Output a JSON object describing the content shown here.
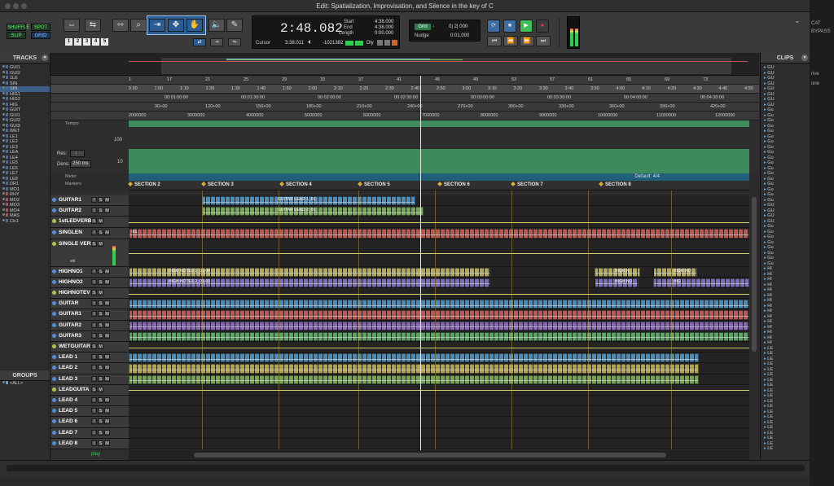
{
  "window": {
    "title": "Edit: Spatialization, Improvisation, and Silence in the key of C"
  },
  "toolbar": {
    "modes": [
      "SHUFFLE",
      "SPOT",
      "SLIP",
      "GRID"
    ],
    "zoom_presets": [
      "1",
      "2",
      "3",
      "4",
      "5"
    ]
  },
  "counter": {
    "main": "2:48.082",
    "start_label": "Start",
    "start": "4:38.000",
    "end_label": "End",
    "end": "4:38.000",
    "length_label": "Length",
    "length": "0:00.000",
    "cursor_label": "Cursor",
    "cursor": "3:38.011",
    "sample": "-1021382",
    "dly": "Dly"
  },
  "grid": {
    "grid_label": "Grid",
    "grid_value": "0| 2| 000",
    "nudge_label": "Nudge",
    "nudge_value": "0:01.000"
  },
  "tracks_panel": {
    "title": "TRACKS",
    "items": [
      "GUI1",
      "GUI2",
      "1LE",
      "SIN",
      "SIN",
      "HIG1",
      "HIG2",
      "HIG",
      "GUIT",
      "GUI1",
      "GUI2",
      "GUI3",
      "WET",
      "LE1",
      "LE2",
      "LE3",
      "LEA",
      "LE4",
      "LE5",
      "LE6",
      "LE7",
      "LE8",
      "DR1",
      "MO1",
      "RHY",
      "MO2",
      "MO3",
      "MO4",
      "MAS",
      "Clc1"
    ]
  },
  "groups_panel": {
    "title": "GROUPS",
    "items": [
      "<ALL>"
    ]
  },
  "clips_panel": {
    "title": "CLIPS",
    "items": [
      "GU",
      "GU",
      "GU",
      "GU",
      "GU",
      "GU",
      "GU",
      "GU",
      "Gu",
      "Gu",
      "Gu",
      "Gu",
      "Gu",
      "Gu",
      "Gu",
      "Gu",
      "Gu",
      "Gu",
      "Gu",
      "Gu",
      "Gu",
      "Gu",
      "Gu",
      "Gu",
      "Gu",
      "Gu",
      "GU",
      "GU",
      "GU",
      "GU",
      "Gu",
      "Gu",
      "Gu",
      "Gu",
      "Gu",
      "Gu",
      "Gu",
      "Gu",
      "HI",
      "HI",
      "HI",
      "HI",
      "HI",
      "HI",
      "HI",
      "HI",
      "HI",
      "HI",
      "HI",
      "HI",
      "HI",
      "HI",
      "HI",
      "LE",
      "LE",
      "LE",
      "LE",
      "LE",
      "LE",
      "LE",
      "LE",
      "LE",
      "LE",
      "LE",
      "LE",
      "LE",
      "LE",
      "LE",
      "LE",
      "LE",
      "LE",
      "LE",
      "LE"
    ]
  },
  "rulers": {
    "labels": [
      "Bars|Beats",
      "Min:Secs",
      "Timecode",
      "Feet+Frames",
      "Samples",
      "Tempo",
      "Meter",
      "Markers"
    ],
    "bars": [
      "1",
      "17",
      "21",
      "25",
      "29",
      "33",
      "37",
      "41",
      "45",
      "49",
      "53",
      "57",
      "61",
      "65",
      "69",
      "73"
    ],
    "minsecs": [
      "0:50",
      "1:00",
      "1:10",
      "1:20",
      "1:30",
      "1:40",
      "1:50",
      "2:00",
      "2:10",
      "2:20",
      "2:30",
      "2:40",
      "2:50",
      "3:00",
      "3:10",
      "3:20",
      "3:30",
      "3:40",
      "3:50",
      "4:00",
      "4:10",
      "4:20",
      "4:30",
      "4:40",
      "4:50"
    ],
    "timecode": [
      "00:01:00:00",
      "00:01:30:00",
      "00:02:00:00",
      "00:02:30:00",
      "00:03:00:00",
      "00:03:30:00",
      "00:04:00:00",
      "00:04:30:00"
    ],
    "feetframes": [
      "90+00",
      "120+00",
      "150+00",
      "180+00",
      "210+00",
      "240+00",
      "270+00",
      "300+00",
      "330+00",
      "360+00",
      "390+00",
      "420+00"
    ],
    "samples": [
      "2000000",
      "3000000",
      "4000000",
      "5000000",
      "6000000",
      "7000000",
      "8000000",
      "9000000",
      "10000000",
      "11000000",
      "12000000"
    ],
    "tempo_values": [
      "100",
      "10"
    ],
    "res_label": "Res:",
    "dens_label": "Dens:",
    "dens_value": "250 ms",
    "meter_default": "Default: 4/4"
  },
  "markers": [
    "SECTION 2",
    "SECTION 3",
    "SECTION 4",
    "SECTION 5",
    "SECTION 6",
    "SECTION 7",
    "SECTION 8"
  ],
  "tracks": [
    {
      "name": "GUITAR1",
      "color": "#4f9fd6",
      "clips": [
        {
          "title": "GUITAR LEAD 1_01"
        }
      ]
    },
    {
      "name": "GUITAR2",
      "color": "#7fbf5a",
      "clips": [
        {
          "title": "GUITAR LEAD 2_01"
        }
      ]
    },
    {
      "name": "1stLEDVERB",
      "color": "#cfd06a",
      "clips": []
    },
    {
      "name": "SINGLEN",
      "color": "#d9605a",
      "clips": [
        {
          "title": "-01"
        }
      ]
    },
    {
      "name": "SINGLE VERB",
      "color": "#cfd06a",
      "clips": []
    },
    {
      "name": "HIGHNO1",
      "color": "#c9c060",
      "clips": [
        {
          "title": "HIGH NOTES 1_01-04"
        },
        {
          "title": "HIGH N"
        },
        {
          "title": "HIGH NO"
        }
      ]
    },
    {
      "name": "HIGHNO2",
      "color": "#8a78d6",
      "clips": [
        {
          "title": "HIGH NOTES 2_01-03"
        },
        {
          "title": "HIGH NO"
        },
        {
          "title": "HIG"
        }
      ]
    },
    {
      "name": "HIGHNOTEV",
      "color": "#cfd06a",
      "clips": []
    },
    {
      "name": "GUITAR",
      "color": "#4f9fd6",
      "clips": [
        {
          "title": ""
        }
      ]
    },
    {
      "name": "GUITAR1",
      "color": "#d9605a",
      "clips": [
        {
          "title": ""
        }
      ]
    },
    {
      "name": "GUITAR2",
      "color": "#9a6fd6",
      "clips": [
        {
          "title": ""
        }
      ]
    },
    {
      "name": "GUITAR3",
      "color": "#5fbf6a",
      "clips": [
        {
          "title": ""
        }
      ]
    },
    {
      "name": "WETGUITAR",
      "color": "#cfd06a",
      "clips": []
    },
    {
      "name": "LEAD 1",
      "color": "#4f9fd6",
      "clips": [
        {
          "title": ""
        }
      ]
    },
    {
      "name": "LEAD 2",
      "color": "#c9b94e",
      "clips": [
        {
          "title": ""
        }
      ]
    },
    {
      "name": "LEAD 3",
      "color": "#7fbf5a",
      "clips": [
        {
          "title": ""
        }
      ]
    },
    {
      "name": "LEADGUITA",
      "color": "#cfd06a",
      "clips": []
    },
    {
      "name": "LEAD 4",
      "color": "#4f9fd6",
      "clips": []
    },
    {
      "name": "LEAD 5",
      "color": "#4f9fd6",
      "clips": []
    },
    {
      "name": "LEAD 6",
      "color": "#4f9fd6",
      "clips": []
    },
    {
      "name": "LEAD 7",
      "color": "#4f9fd6",
      "clips": []
    },
    {
      "name": "LEAD 8",
      "color": "#4f9fd6",
      "clips": []
    }
  ],
  "track_btn_labels": {
    "solo": "S",
    "mute": "M",
    "input": "I"
  },
  "single_verb": {
    "vol": "vol"
  },
  "bottom": {
    "play": "play"
  },
  "right_edge": {
    "text1": "CAT",
    "text2": "BYPASS",
    "text3": "rive",
    "text4": "one"
  }
}
